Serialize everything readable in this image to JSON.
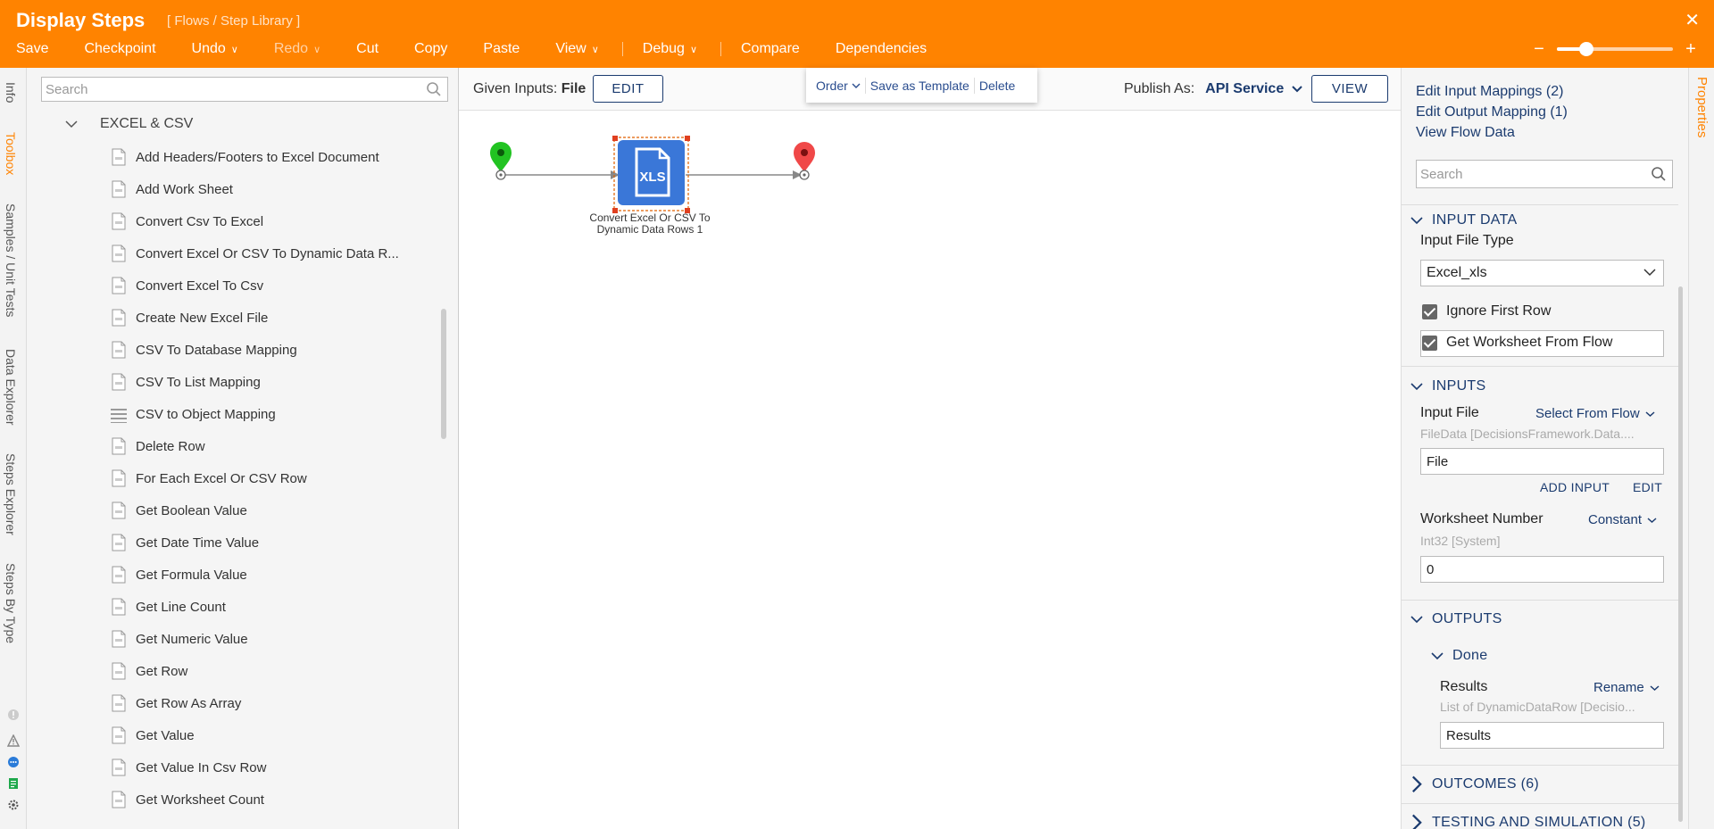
{
  "header": {
    "title": "Display Steps",
    "breadcrumb": "[ Flows / Step Library ]",
    "close_glyph": "✕",
    "menu": [
      "Save",
      "Checkpoint",
      "Undo",
      "Redo",
      "Cut",
      "Copy",
      "Paste",
      "View",
      "Debug",
      "Compare",
      "Dependencies"
    ],
    "zoom_minus": "−",
    "zoom_plus": "+",
    "zoom_level": 0.25
  },
  "left_tabs": [
    "Info",
    "Toolbox",
    "Samples / Unit Tests",
    "Data Explorer",
    "Steps Explorer",
    "Steps By Type"
  ],
  "toolbox": {
    "search_placeholder": "Search",
    "category": "EXCEL & CSV",
    "steps": [
      "Add Headers/Footers to Excel Document",
      "Add Work Sheet",
      "Convert Csv To Excel",
      "Convert Excel Or CSV To Dynamic Data R...",
      "Convert Excel To Csv",
      "Create New Excel File",
      "CSV To Database Mapping",
      "CSV To List Mapping",
      "CSV to Object Mapping",
      "Delete Row",
      "For Each Excel Or CSV Row",
      "Get Boolean Value",
      "Get Date Time Value",
      "Get Formula Value",
      "Get Line Count",
      "Get Numeric Value",
      "Get Row",
      "Get Row As Array",
      "Get Value",
      "Get Value In Csv Row",
      "Get Worksheet Count"
    ]
  },
  "canvas": {
    "given_inputs_label": "Given Inputs:",
    "given_inputs_value": "File",
    "edit_button": "EDIT",
    "publish_label": "Publish As:",
    "publish_value": "API Service",
    "view_button": "VIEW",
    "context_menu": {
      "order": "Order",
      "save_template": "Save as Template",
      "delete": "Delete"
    },
    "node": {
      "icon_text": "XLS",
      "label_line1": "Convert Excel Or CSV To",
      "label_line2": "Dynamic Data Rows 1"
    },
    "colors": {
      "start": "#22c322",
      "end": "#f04848",
      "node": "#3a77d8"
    }
  },
  "properties": {
    "tab": "Properties",
    "links": [
      "Edit Input Mappings (2)",
      "Edit Output Mapping (1)",
      "View Flow Data"
    ],
    "search_placeholder": "Search",
    "input_data": {
      "header": "INPUT DATA",
      "file_type_label": "Input File Type",
      "file_type_value": "Excel_xls",
      "ignore_first_row": "Ignore First Row",
      "get_worksheet": "Get Worksheet From Flow"
    },
    "inputs": {
      "header": "INPUTS",
      "input_file_label": "Input File",
      "input_file_mode": "Select From Flow",
      "input_file_type": "FileData [DecisionsFramework.Data....",
      "input_file_value": "File",
      "add_input": "ADD INPUT",
      "edit": "EDIT",
      "worksheet_label": "Worksheet Number",
      "worksheet_mode": "Constant",
      "worksheet_type": "Int32 [System]",
      "worksheet_value": "0"
    },
    "outputs": {
      "header": "OUTPUTS",
      "done": "Done",
      "results_label": "Results",
      "results_mode": "Rename",
      "results_type": "List of DynamicDataRow [Decisio...",
      "results_value": "Results"
    },
    "outcomes": "OUTCOMES (6)",
    "testing": "TESTING AND SIMULATION (5)"
  }
}
